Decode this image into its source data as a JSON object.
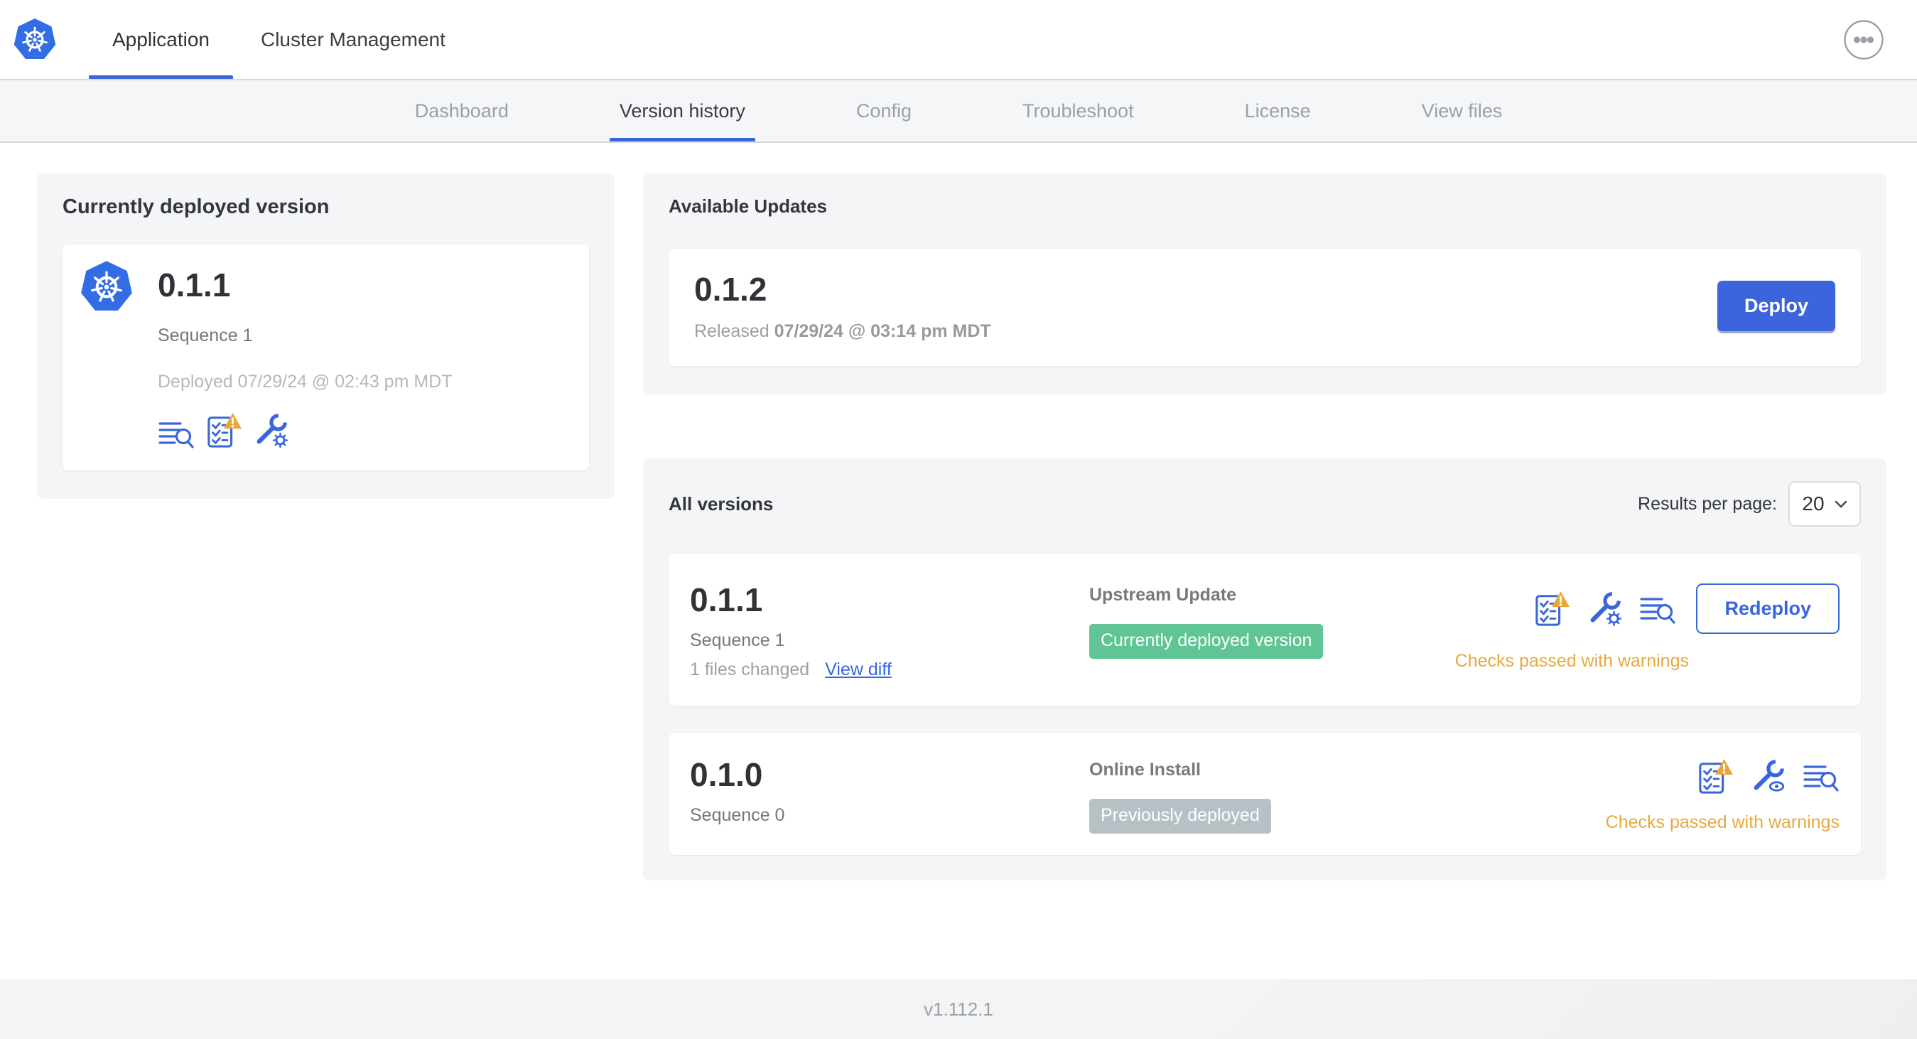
{
  "header": {
    "tabs": [
      {
        "label": "Application",
        "active": true
      },
      {
        "label": "Cluster Management",
        "active": false
      }
    ]
  },
  "subnav": {
    "tabs": [
      {
        "label": "Dashboard",
        "active": false
      },
      {
        "label": "Version history",
        "active": true
      },
      {
        "label": "Config",
        "active": false
      },
      {
        "label": "Troubleshoot",
        "active": false
      },
      {
        "label": "License",
        "active": false
      },
      {
        "label": "View files",
        "active": false
      }
    ]
  },
  "current_version_card": {
    "title": "Currently deployed version",
    "version": "0.1.1",
    "sequence": "Sequence 1",
    "deployed": "Deployed 07/29/24 @ 02:43 pm MDT",
    "icons": [
      "logs-icon",
      "preflight-checks-warning-icon",
      "config-gear-icon"
    ]
  },
  "available_updates": {
    "title": "Available Updates",
    "version": "0.1.2",
    "released_label": "Released",
    "released_date": "07/29/24 @ 03:14 pm MDT",
    "deploy_button": "Deploy"
  },
  "all_versions": {
    "title": "All versions",
    "results_per_page_label": "Results per page:",
    "results_per_page_value": "20",
    "rows": [
      {
        "version": "0.1.1",
        "sequence": "Sequence 1",
        "files_changed": "1 files changed",
        "view_diff_link": "View diff",
        "source": "Upstream Update",
        "status_badge": "Currently deployed version",
        "badge_color": "green",
        "action_button": "Redeploy",
        "checks_text": "Checks passed with warnings",
        "icons": [
          "preflight-checks-warning-icon",
          "config-gear-icon",
          "logs-icon"
        ]
      },
      {
        "version": "0.1.0",
        "sequence": "Sequence 0",
        "source": "Online Install",
        "status_badge": "Previously deployed",
        "badge_color": "gray",
        "checks_text": "Checks passed with warnings",
        "icons": [
          "preflight-checks-warning-icon",
          "config-view-icon",
          "logs-icon"
        ]
      }
    ]
  },
  "footer": {
    "version": "v1.112.1"
  },
  "colors": {
    "accent_blue": "#3a66dc",
    "kubernetes_blue": "#326de6",
    "deploy_button_blue": "#3c64dc",
    "green_badge": "#61c495",
    "gray_badge": "#b5c1c5",
    "warning_orange": "#e7a93f",
    "card_background": "#f4f5f7",
    "subnav_background": "#f4f6f8"
  }
}
